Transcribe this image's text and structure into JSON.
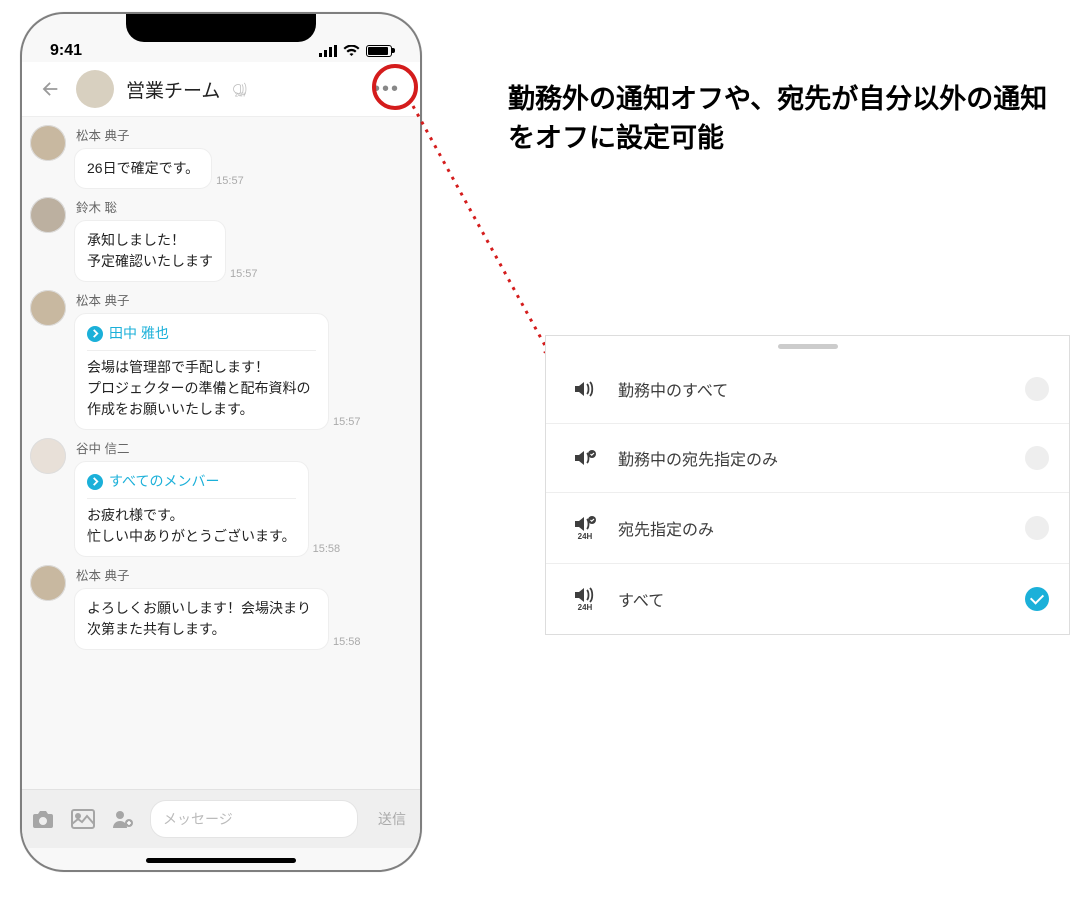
{
  "status": {
    "time": "9:41"
  },
  "header": {
    "title": "営業チーム",
    "badge": "24H"
  },
  "messages": [
    {
      "sender": "松本 典子",
      "body": "26日で確定です。",
      "time": "15:57",
      "avatar": "m"
    },
    {
      "sender": "鈴木 聡",
      "body": "承知しました！\n予定確認いたします",
      "time": "15:57",
      "avatar": "s"
    },
    {
      "sender": "松本 典子",
      "mention": "田中 雅也",
      "body": "会場は管理部で手配します！\nプロジェクターの準備と配布資料の作成をお願いいたします。",
      "time": "15:57",
      "avatar": "m"
    },
    {
      "sender": "谷中 信二",
      "mention": "すべてのメンバー",
      "body": "お疲れ様です。\n忙しい中ありがとうございます。",
      "time": "15:58",
      "avatar": "t"
    },
    {
      "sender": "松本 典子",
      "body": "よろしくお願いします！会場決まり次第また共有します。",
      "time": "15:58",
      "avatar": "m"
    }
  ],
  "compose": {
    "placeholder": "メッセージ",
    "send": "送信"
  },
  "caption": "勤務外の通知オフや、宛先が自分以外の通知をオフに設定可能",
  "settings": {
    "options": [
      {
        "label": "勤務中のすべて",
        "sub": "",
        "checked": false
      },
      {
        "label": "勤務中の宛先指定のみ",
        "sub": "",
        "checked": false
      },
      {
        "label": "宛先指定のみ",
        "sub": "24H",
        "checked": false
      },
      {
        "label": "すべて",
        "sub": "24H",
        "checked": true
      }
    ]
  }
}
